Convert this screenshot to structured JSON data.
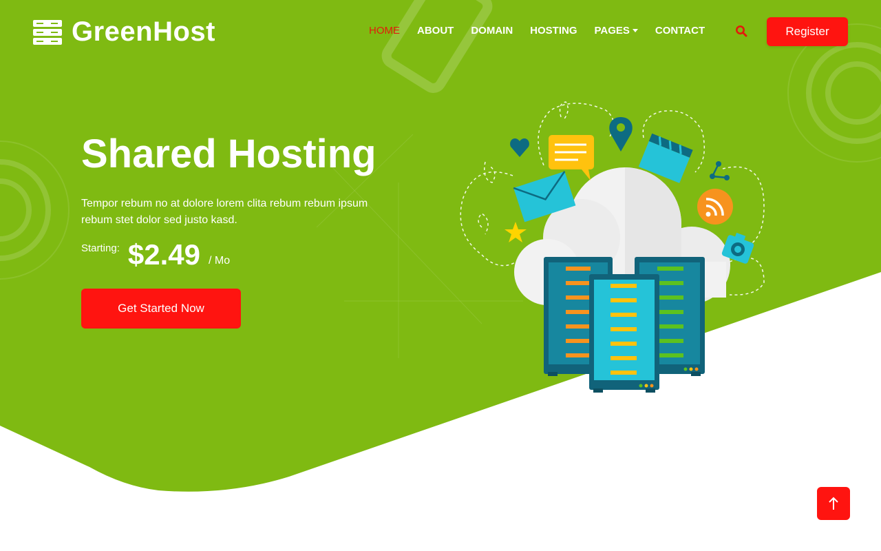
{
  "brand": {
    "name": "GreenHost",
    "icon": "server-stack-icon"
  },
  "nav": {
    "items": [
      {
        "label": "HOME",
        "active": true
      },
      {
        "label": "ABOUT",
        "active": false
      },
      {
        "label": "DOMAIN",
        "active": false
      },
      {
        "label": "HOSTING",
        "active": false
      },
      {
        "label": "PAGES",
        "active": false,
        "dropdown": true
      },
      {
        "label": "CONTACT",
        "active": false
      }
    ],
    "search_icon": "search-icon",
    "register_label": "Register"
  },
  "hero": {
    "title": "Shared Hosting",
    "description": "Tempor rebum no at dolore lorem clita rebum rebum ipsum rebum stet dolor sed justo kasd.",
    "price_label": "Starting:",
    "price": "$2.49",
    "price_unit": "/ Mo",
    "cta_label": "Get Started Now"
  },
  "back_to_top_icon": "arrow-up-icon",
  "colors": {
    "primary_green": "#7fba12",
    "accent_red": "#ff1410",
    "active_nav": "#e21b0c",
    "white": "#ffffff"
  }
}
